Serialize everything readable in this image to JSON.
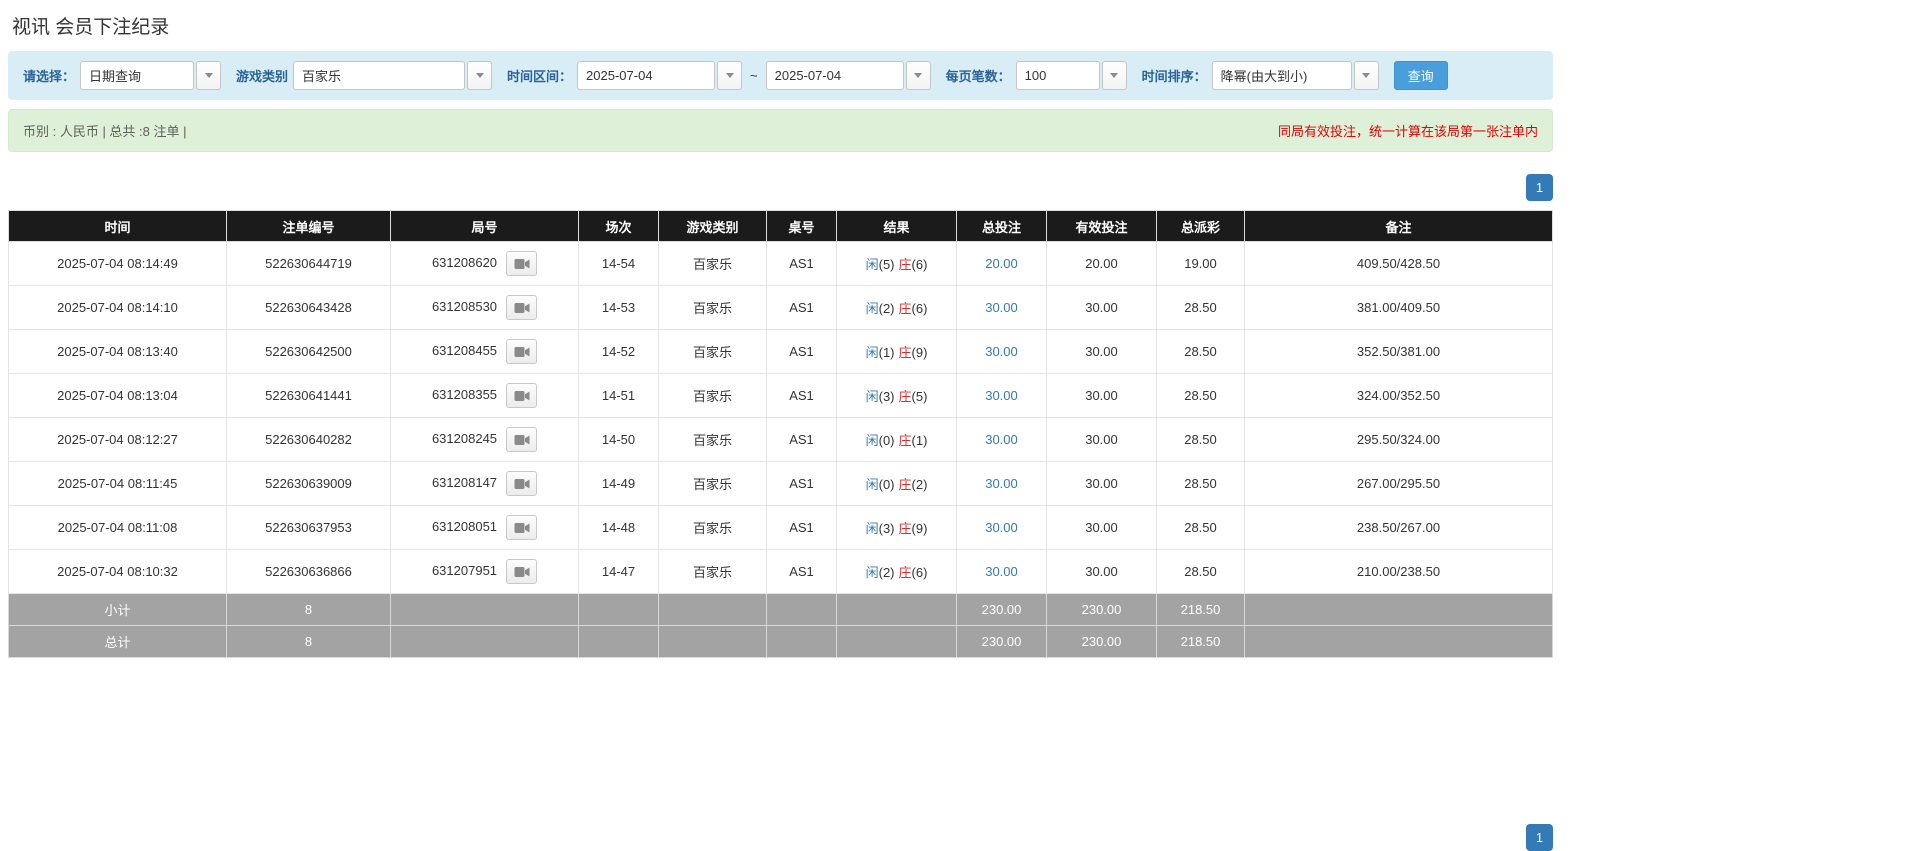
{
  "page": {
    "title": "视讯 会员下注纪录"
  },
  "colors": {
    "accent_blue": "#337ab7",
    "filter_bar_bg": "#d9edf7",
    "info_bar_bg": "#dff0d8",
    "table_header_bg": "#1b1b1b",
    "table_footer_bg": "#a3a3a3",
    "player_blue": "#337ab7",
    "banker_red": "#e02b2b",
    "notice_red": "#e60000",
    "search_button_blue": "#4a9edb"
  },
  "icons": {
    "dropdown": "chevron-down-icon",
    "video": "video-icon"
  },
  "filters": {
    "select_label": "请选择：",
    "select_value": "日期查询",
    "game_type_label": "游戏类别",
    "game_type_value": "百家乐",
    "time_range_label": "时间区间：",
    "date_from": "2025-07-04",
    "date_separator": "~",
    "date_to": "2025-07-04",
    "page_size_label": "每页笔数：",
    "page_size_value": "100",
    "sort_label": "时间排序：",
    "sort_value": "降幂(由大到小)",
    "search_button": "查询"
  },
  "summary": {
    "left_text": "币别 : 人民币 | 总共 :8 注单 |",
    "right_text": "同局有效投注，统一计算在该局第一张注单内"
  },
  "pagination": {
    "page": "1"
  },
  "table": {
    "headers": [
      "时间",
      "注单编号",
      "局号",
      "场次",
      "游戏类别",
      "桌号",
      "结果",
      "总投注",
      "有效投注",
      "总派彩",
      "备注"
    ],
    "rows": [
      {
        "time": "2025-07-04 08:14:49",
        "bet_id": "522630644719",
        "round_id": "631208620",
        "session": "14-54",
        "game": "百家乐",
        "table_no": "AS1",
        "result_player_label": "闲",
        "result_player_score": "(5)",
        "result_banker_label": "庄",
        "result_banker_score": "(6)",
        "total_bet": "20.00",
        "valid_bet": "20.00",
        "payout": "19.00",
        "remark": "409.50/428.50"
      },
      {
        "time": "2025-07-04 08:14:10",
        "bet_id": "522630643428",
        "round_id": "631208530",
        "session": "14-53",
        "game": "百家乐",
        "table_no": "AS1",
        "result_player_label": "闲",
        "result_player_score": "(2)",
        "result_banker_label": "庄",
        "result_banker_score": "(6)",
        "total_bet": "30.00",
        "valid_bet": "30.00",
        "payout": "28.50",
        "remark": "381.00/409.50"
      },
      {
        "time": "2025-07-04 08:13:40",
        "bet_id": "522630642500",
        "round_id": "631208455",
        "session": "14-52",
        "game": "百家乐",
        "table_no": "AS1",
        "result_player_label": "闲",
        "result_player_score": "(1)",
        "result_banker_label": "庄",
        "result_banker_score": "(9)",
        "total_bet": "30.00",
        "valid_bet": "30.00",
        "payout": "28.50",
        "remark": "352.50/381.00"
      },
      {
        "time": "2025-07-04 08:13:04",
        "bet_id": "522630641441",
        "round_id": "631208355",
        "session": "14-51",
        "game": "百家乐",
        "table_no": "AS1",
        "result_player_label": "闲",
        "result_player_score": "(3)",
        "result_banker_label": "庄",
        "result_banker_score": "(5)",
        "total_bet": "30.00",
        "valid_bet": "30.00",
        "payout": "28.50",
        "remark": "324.00/352.50"
      },
      {
        "time": "2025-07-04 08:12:27",
        "bet_id": "522630640282",
        "round_id": "631208245",
        "session": "14-50",
        "game": "百家乐",
        "table_no": "AS1",
        "result_player_label": "闲",
        "result_player_score": "(0)",
        "result_banker_label": "庄",
        "result_banker_score": "(1)",
        "total_bet": "30.00",
        "valid_bet": "30.00",
        "payout": "28.50",
        "remark": "295.50/324.00"
      },
      {
        "time": "2025-07-04 08:11:45",
        "bet_id": "522630639009",
        "round_id": "631208147",
        "session": "14-49",
        "game": "百家乐",
        "table_no": "AS1",
        "result_player_label": "闲",
        "result_player_score": "(0)",
        "result_banker_label": "庄",
        "result_banker_score": "(2)",
        "total_bet": "30.00",
        "valid_bet": "30.00",
        "payout": "28.50",
        "remark": "267.00/295.50"
      },
      {
        "time": "2025-07-04 08:11:08",
        "bet_id": "522630637953",
        "round_id": "631208051",
        "session": "14-48",
        "game": "百家乐",
        "table_no": "AS1",
        "result_player_label": "闲",
        "result_player_score": "(3)",
        "result_banker_label": "庄",
        "result_banker_score": "(9)",
        "total_bet": "30.00",
        "valid_bet": "30.00",
        "payout": "28.50",
        "remark": "238.50/267.00"
      },
      {
        "time": "2025-07-04 08:10:32",
        "bet_id": "522630636866",
        "round_id": "631207951",
        "session": "14-47",
        "game": "百家乐",
        "table_no": "AS1",
        "result_player_label": "闲",
        "result_player_score": "(2)",
        "result_banker_label": "庄",
        "result_banker_score": "(6)",
        "total_bet": "30.00",
        "valid_bet": "30.00",
        "payout": "28.50",
        "remark": "210.00/238.50"
      }
    ],
    "subtotal": {
      "label": "小计",
      "count": "8",
      "total_bet": "230.00",
      "valid_bet": "230.00",
      "payout": "218.50"
    },
    "total": {
      "label": "总计",
      "count": "8",
      "total_bet": "230.00",
      "valid_bet": "230.00",
      "payout": "218.50"
    }
  }
}
